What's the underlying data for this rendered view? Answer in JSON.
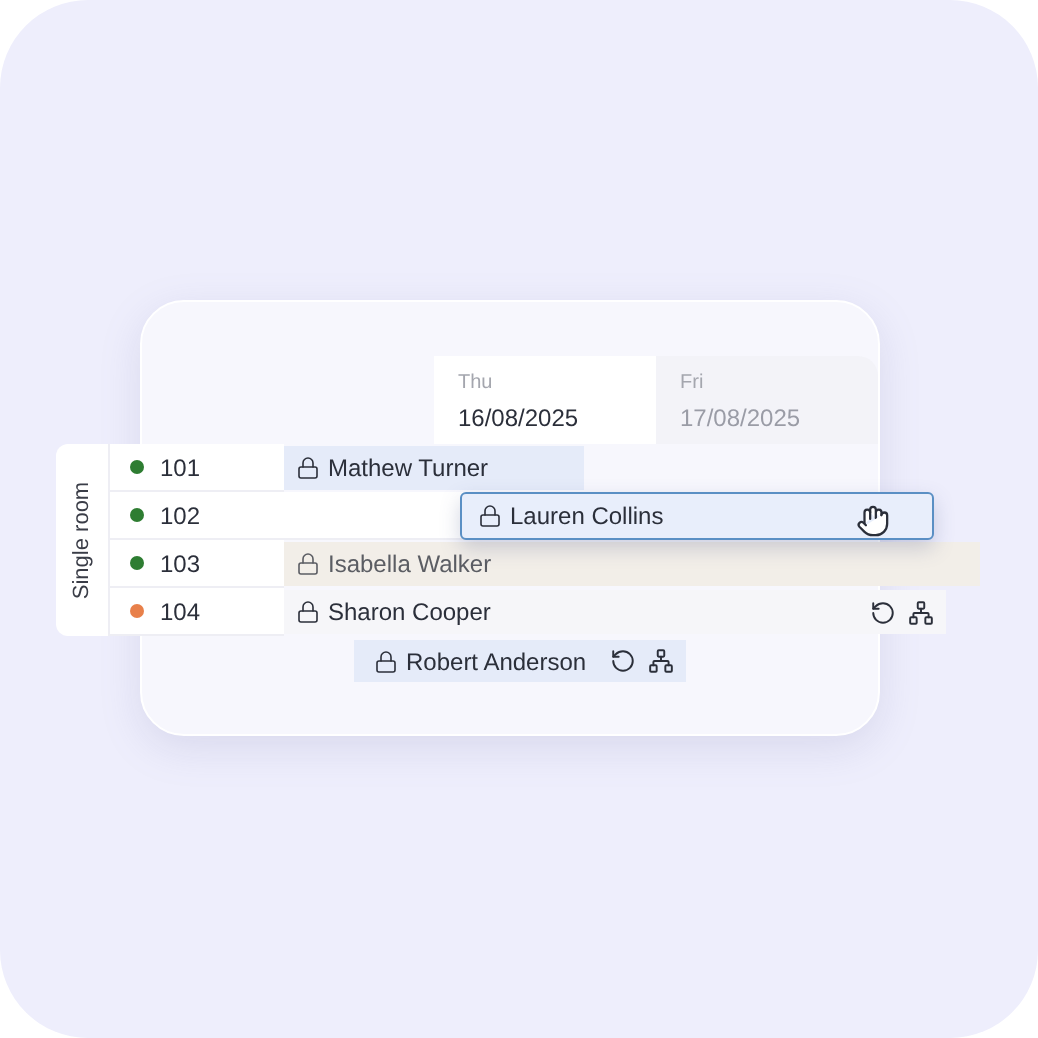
{
  "days": [
    {
      "weekday": "Thu",
      "date": "16/08/2025",
      "selected": true
    },
    {
      "weekday": "Fri",
      "date": "17/08/2025",
      "selected": false
    }
  ],
  "room_group": {
    "label": "Single room"
  },
  "rooms": [
    {
      "number": "101",
      "color": "#2e7d32",
      "booking": {
        "guest": "Mathew Turner",
        "kind": "current",
        "actions": false
      }
    },
    {
      "number": "102",
      "color": "#2e7d32"
    },
    {
      "number": "103",
      "color": "#2e7d32",
      "booking": {
        "guest": "Isabella Walker",
        "kind": "past",
        "actions": false
      }
    },
    {
      "number": "104",
      "color": "#e8804a",
      "booking": {
        "guest": "Sharon Cooper",
        "kind": "pending",
        "actions": true
      }
    }
  ],
  "dragged_booking": {
    "guest": "Lauren Collins",
    "dragging": true
  },
  "unassigned_booking": {
    "guest": "Robert Anderson",
    "actions": true
  }
}
